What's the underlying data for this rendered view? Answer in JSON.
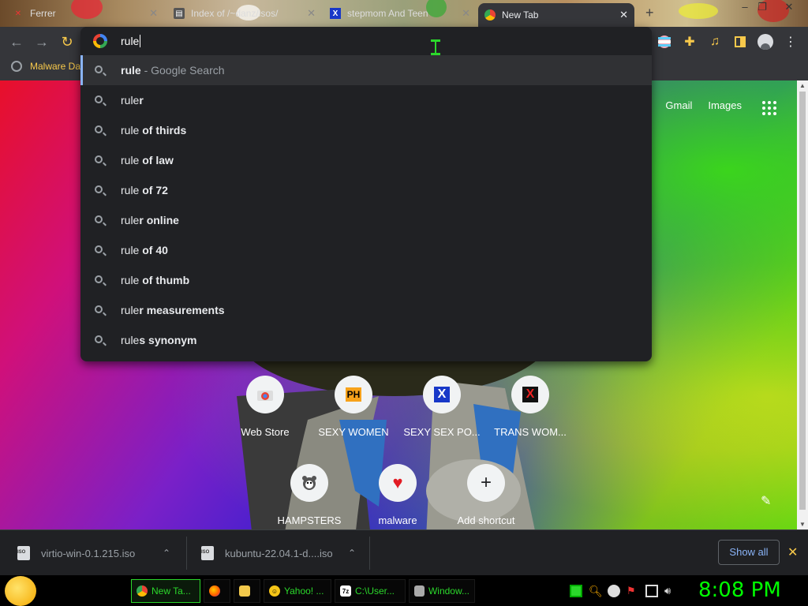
{
  "tabs": [
    {
      "title": "Ferrer",
      "favicon": "x-icon"
    },
    {
      "title": "Index of /~danz/isos/",
      "favicon": "folder-icon"
    },
    {
      "title": "stepmom And Teen",
      "favicon": "x-site-icon"
    },
    {
      "title": "New Tab",
      "favicon": "chrome-icon",
      "active": true
    }
  ],
  "bookmarks": [
    {
      "label": "Malware Da"
    }
  ],
  "omnibox": {
    "input_value": "rule",
    "suggestions": [
      {
        "prefix": "rule",
        "suffix": "",
        "note": " - Google Search",
        "selected": true
      },
      {
        "prefix": "rule",
        "suffix": "r",
        "note": ""
      },
      {
        "prefix": "rule",
        "suffix": " of thirds",
        "note": ""
      },
      {
        "prefix": "rule",
        "suffix": " of law",
        "note": ""
      },
      {
        "prefix": "rule",
        "suffix": " of 72",
        "note": ""
      },
      {
        "prefix": "rule",
        "suffix": "r online",
        "note": ""
      },
      {
        "prefix": "rule",
        "suffix": " of 40",
        "note": ""
      },
      {
        "prefix": "rule",
        "suffix": " of thumb",
        "note": ""
      },
      {
        "prefix": "rule",
        "suffix": "r measurements",
        "note": ""
      },
      {
        "prefix": "rule",
        "suffix": "s synonym",
        "note": ""
      }
    ]
  },
  "page": {
    "top_links": {
      "gmail": "Gmail",
      "images": "Images"
    },
    "shortcuts": [
      {
        "label": "Web Store",
        "icon": "web-store-icon",
        "glyph": ""
      },
      {
        "label": "SEXY WOMEN",
        "icon": "ph-icon",
        "glyph": "PH"
      },
      {
        "label": "SEXY SEX PO...",
        "icon": "x-blue-icon",
        "glyph": "X"
      },
      {
        "label": "TRANS WOM...",
        "icon": "x-red-icon",
        "glyph": "X"
      },
      {
        "label": "HAMPSTERS",
        "icon": "hamster-icon",
        "glyph": ""
      },
      {
        "label": "malware",
        "icon": "heart-icon",
        "glyph": "♥"
      },
      {
        "label": "Add shortcut",
        "icon": "plus-icon",
        "glyph": "+"
      }
    ]
  },
  "downloads": {
    "items": [
      {
        "filename": "virtio-win-0.1.215.iso"
      },
      {
        "filename": "kubuntu-22.04.1-d....iso"
      }
    ],
    "show_all": "Show all"
  },
  "taskbar": {
    "buttons": [
      {
        "label": "New Ta...",
        "icon": "chrome-icon",
        "active": true
      },
      {
        "label": "",
        "icon": "firefox-icon"
      },
      {
        "label": "",
        "icon": "folder-icon"
      },
      {
        "label": "Yahoo! ...",
        "icon": "yahoo-icon"
      },
      {
        "label": "C:\\User...",
        "icon": "7zip-icon"
      },
      {
        "label": "Window...",
        "icon": "window-icon"
      }
    ],
    "clock": "8:08 PM"
  },
  "colors": {
    "chrome_dark": "#35363a",
    "omnibox_bg": "#202124",
    "bookmark_text": "#f8c94b",
    "taskbar_green": "#2bd82b",
    "clock_green": "#00ff00",
    "link_blue": "#8ab4f8"
  }
}
